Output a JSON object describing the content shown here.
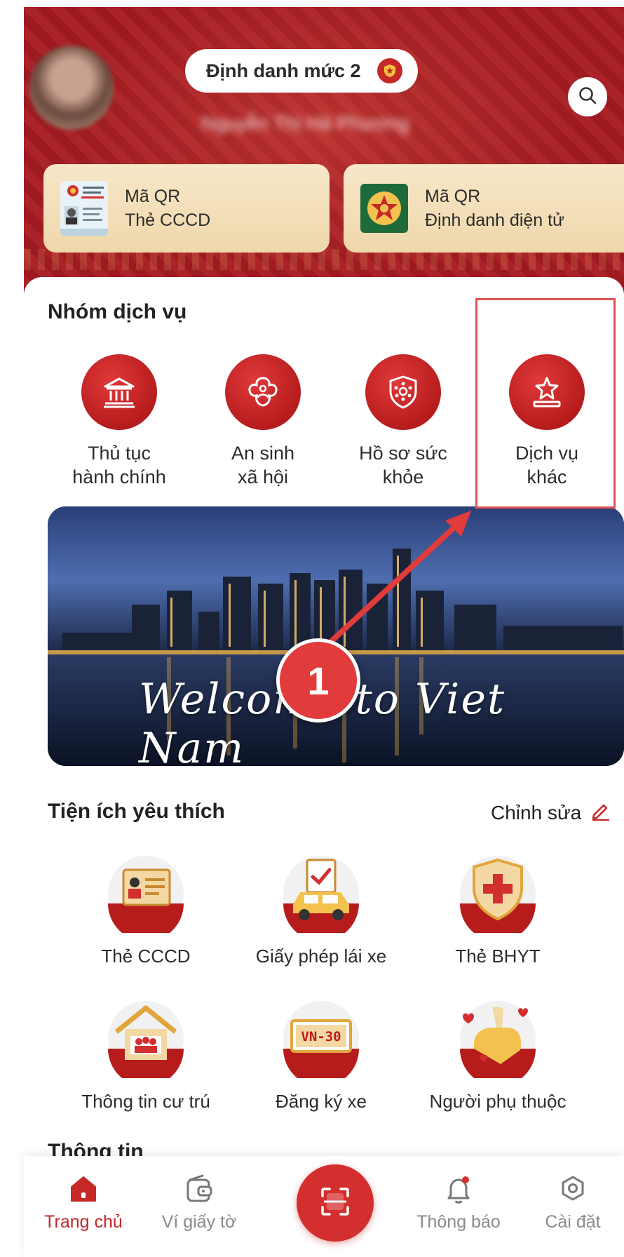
{
  "header": {
    "id_level": "Định danh mức 2",
    "user_name": "Nguyễn Thị Hà Phương",
    "qr_cards": [
      {
        "title": "Mã QR",
        "subtitle": "Thẻ CCCD"
      },
      {
        "title": "Mã QR",
        "subtitle": "Định danh điện tử"
      }
    ]
  },
  "services": {
    "title": "Nhóm dịch vụ",
    "items": [
      {
        "label": "Thủ tục\nhành chính",
        "icon": "government-building-icon"
      },
      {
        "label": "An sinh\nxã hội",
        "icon": "social-welfare-icon"
      },
      {
        "label": "Hồ sơ sức\nkhỏe",
        "icon": "health-shield-icon"
      },
      {
        "label": "Dịch vụ\nkhác",
        "icon": "star-podium-icon"
      }
    ]
  },
  "banner": {
    "text": "Welcome to Viet Nam"
  },
  "annotation": {
    "step": "1"
  },
  "favorites": {
    "title": "Tiện ích yêu thích",
    "edit_label": "Chỉnh sửa",
    "items": [
      {
        "label": "Thẻ CCCD",
        "icon": "id-card-icon"
      },
      {
        "label": "Giấy phép lái xe",
        "icon": "driver-license-icon"
      },
      {
        "label": "Thẻ BHYT",
        "icon": "health-insurance-icon"
      },
      {
        "label": "Thông tin cư trú",
        "icon": "residence-icon"
      },
      {
        "label": "Đăng ký xe",
        "icon": "vehicle-registration-icon",
        "plate": "VN-30"
      },
      {
        "label": "Người phụ thuộc",
        "icon": "dependents-icon"
      }
    ]
  },
  "next_section": {
    "title": "Thông tin"
  },
  "bottom_nav": {
    "items": [
      {
        "label": "Trang chủ",
        "icon": "home-icon",
        "active": true
      },
      {
        "label": "Ví giấy tờ",
        "icon": "wallet-icon",
        "active": false
      },
      {
        "label": "Thông báo",
        "icon": "bell-icon",
        "active": false
      },
      {
        "label": "Cài đặt",
        "icon": "settings-icon",
        "active": false
      }
    ]
  },
  "colors": {
    "brand_red": "#c62828",
    "header_red": "#a71c22",
    "card_beige": "#f2dcb2",
    "highlight": "#e05454"
  }
}
